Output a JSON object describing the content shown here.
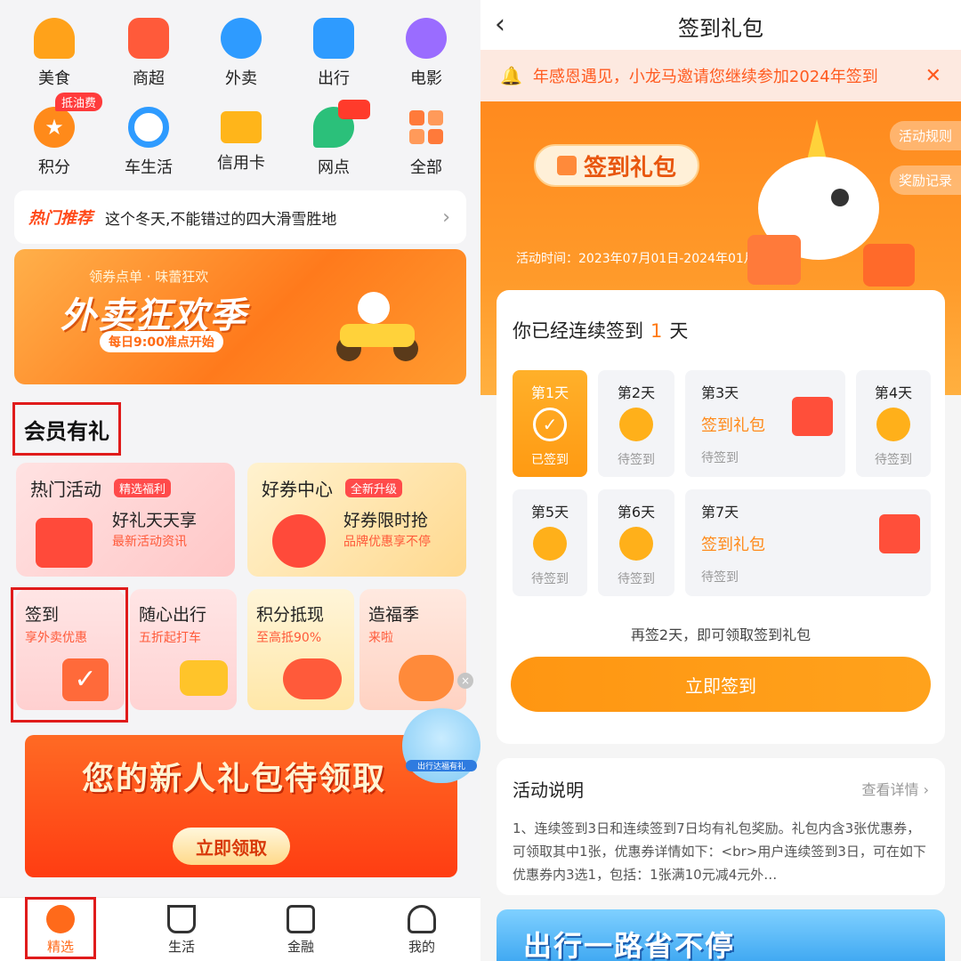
{
  "left": {
    "grid": [
      {
        "label": "美食",
        "icon": "food-icon",
        "color": "#ffa21a"
      },
      {
        "label": "商超",
        "icon": "store-icon",
        "color": "#ff5a3a"
      },
      {
        "label": "外卖",
        "icon": "scooter-icon",
        "color": "#2e9bff"
      },
      {
        "label": "出行",
        "icon": "bus-icon",
        "color": "#2e9bff"
      },
      {
        "label": "电影",
        "icon": "film-icon",
        "color": "#9a6cff"
      },
      {
        "label": "积分",
        "icon": "star-icon",
        "color": "#ff8a1a"
      },
      {
        "label": "车生活",
        "icon": "steering-wheel-icon",
        "color": "#2e9bff"
      },
      {
        "label": "信用卡",
        "icon": "credit-card-icon",
        "color": "#ffb51a"
      },
      {
        "label": "网点",
        "icon": "location-icon",
        "color": "#2bc07a"
      },
      {
        "label": "全部",
        "icon": "grid-icon",
        "color": "#ff7a3a"
      }
    ],
    "oil_badge": "抵油费",
    "hot": {
      "tag": "热门推荐",
      "text": "这个冬天,不能错过的四大滑雪胜地"
    },
    "banner1": {
      "subtitle": "领券点单 · 味蕾狂欢",
      "title": "外卖狂欢季",
      "button": "每日9:00准点开始"
    },
    "member_title": "会员有礼",
    "card_hot": {
      "title": "热门活动",
      "tag": "精选福利",
      "line1": "好礼天天享",
      "line2": "最新活动资讯"
    },
    "card_coupon": {
      "title": "好券中心",
      "tag": "全新升级",
      "line1": "好券限时抢",
      "line2": "品牌优惠享不停"
    },
    "small_cards": [
      {
        "title": "签到",
        "sub": "享外卖优惠"
      },
      {
        "title": "随心出行",
        "sub": "五折起打车"
      },
      {
        "title": "积分抵现",
        "sub": "至高抵90%"
      },
      {
        "title": "造福季",
        "sub": "来啦"
      }
    ],
    "banner2": {
      "title": "您的新人礼包待领取",
      "button": "立即领取"
    },
    "float_ad": "出行达福有礼",
    "tabs": [
      {
        "label": "精选",
        "icon": "home-icon"
      },
      {
        "label": "生活",
        "icon": "coffee-icon"
      },
      {
        "label": "金融",
        "icon": "wallet-icon"
      },
      {
        "label": "我的",
        "icon": "user-icon"
      }
    ]
  },
  "right": {
    "title": "签到礼包",
    "notice": "年感恩遇见，小龙马邀请您继续参加2024年签到",
    "hero": {
      "pill": "签到礼包",
      "rules": "活动规则",
      "record": "奖励记录",
      "time": "活动时间：2023年07月01日-2024年01月31日"
    },
    "checkin": {
      "prefix": "你已经连续签到",
      "days": "1",
      "suffix": "天",
      "items": [
        {
          "label": "第1天",
          "status": "已签到"
        },
        {
          "label": "第2天",
          "status": "待签到"
        },
        {
          "label": "第3天",
          "gift": "签到礼包",
          "status": "待签到"
        },
        {
          "label": "第4天",
          "status": "待签到"
        },
        {
          "label": "第5天",
          "status": "待签到"
        },
        {
          "label": "第6天",
          "status": "待签到"
        },
        {
          "label": "第7天",
          "gift": "签到礼包",
          "status": "待签到"
        }
      ],
      "hint": "再签2天，即可领取签到礼包",
      "button": "立即签到"
    },
    "rules": {
      "title": "活动说明",
      "detail": "查看详情",
      "body": "1、连续签到3日和连续签到7日均有礼包奖励。礼包内含3张优惠券，可领取其中1张，优惠券详情如下：<br>用户连续签到3日，可在如下优惠券内3选1，包括：1张满10元减4元外…"
    },
    "bottom_ad": "出行一路省不停"
  }
}
